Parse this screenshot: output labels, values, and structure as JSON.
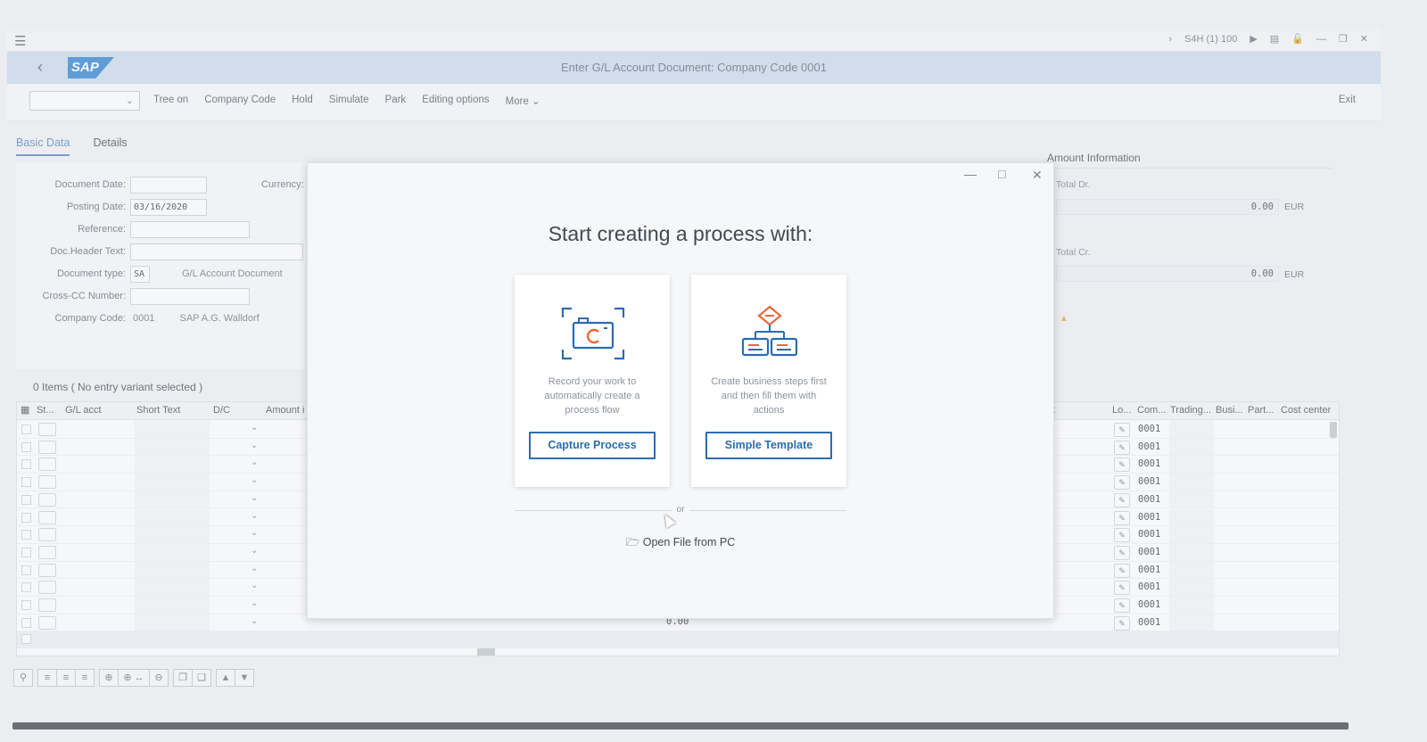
{
  "system": {
    "info": "S4H (1) 100"
  },
  "shell": {
    "logo_text": "SAP",
    "title": "Enter G/L Account Document: Company Code 0001"
  },
  "toolbar": {
    "items": [
      "Tree on",
      "Company Code",
      "Hold",
      "Simulate",
      "Park",
      "Editing options",
      "More"
    ],
    "exit": "Exit"
  },
  "tabs": [
    "Basic Data",
    "Details"
  ],
  "form": {
    "document_date_label": "Document Date:",
    "document_date_value": "",
    "posting_date_label": "Posting Date:",
    "posting_date_value": "03/16/2020",
    "reference_label": "Reference:",
    "doc_header_label": "Doc.Header Text:",
    "document_type_label": "Document type:",
    "document_type_value": "SA",
    "document_type_text": "G/L Account Document",
    "cross_cc_label": "Cross-CC Number:",
    "company_code_label": "Company Code:",
    "company_code_value": "0001",
    "company_code_text": "SAP A.G. Walldorf",
    "currency_label": "Currency:"
  },
  "amount_info": {
    "title": "Amount Information",
    "total_dr_label": "Total Dr.",
    "total_dr_value": "0.00",
    "total_cr_label": "Total Cr.",
    "total_cr_value": "0.00",
    "currency": "EUR"
  },
  "items": {
    "title": "0 Items ( No entry variant selected )",
    "columns": {
      "st": "St...",
      "gl_acct": "G/L acct",
      "short_text": "Short Text",
      "dc": "D/C",
      "amount": "Amount i",
      "t": "t",
      "lo": "Lo...",
      "com": "Com...",
      "trading": "Trading...",
      "busi": "Busi...",
      "part": "Part...",
      "cost_center": "Cost center"
    },
    "company_code_cell": "0001",
    "amount_cell": "0.00"
  },
  "dialog": {
    "title": "Start creating a process with:",
    "capture": {
      "description": "Record your work to automatically create a process flow",
      "button": "Capture Process"
    },
    "template": {
      "description": "Create business steps first and then fill them with actions",
      "button": "Simple Template"
    },
    "or": "or",
    "open_file": "Open File from PC"
  }
}
